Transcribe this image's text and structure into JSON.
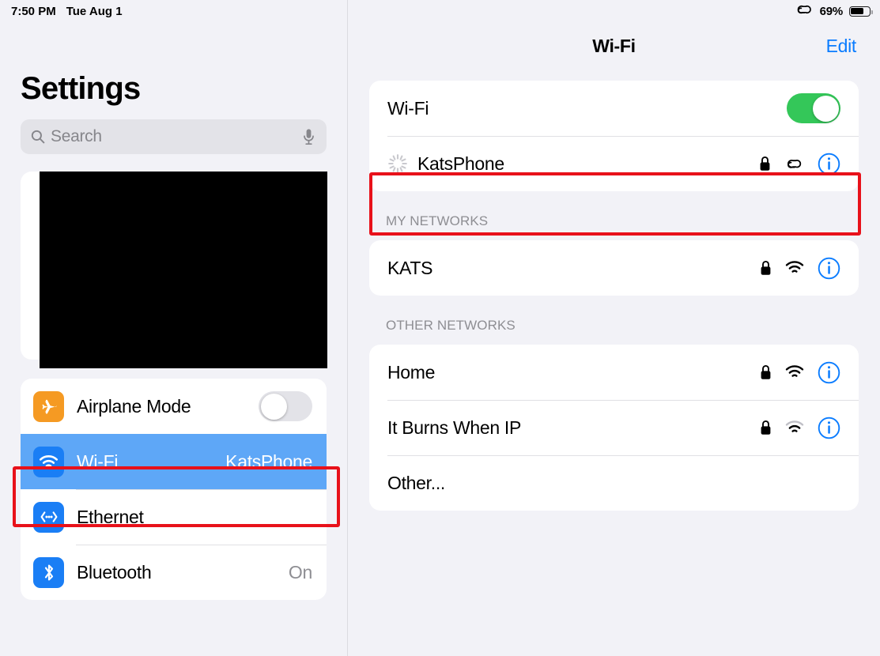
{
  "status_bar": {
    "time": "7:50 PM",
    "date": "Tue Aug 1",
    "battery_percent": "69%",
    "hotspot_icon": "hotspot-link-icon",
    "battery_icon": "battery-icon"
  },
  "sidebar": {
    "title": "Settings",
    "search": {
      "placeholder": "Search",
      "value": "",
      "icon": "search-icon",
      "dictation_icon": "microphone-icon"
    },
    "account_card": {
      "redacted": true
    },
    "items": [
      {
        "label": "Airplane Mode",
        "icon": "airplane-icon",
        "control": "toggle",
        "toggle_on": false,
        "value": ""
      },
      {
        "label": "Wi-Fi",
        "icon": "wifi-icon",
        "control": "value",
        "value": "KatsPhone",
        "selected": true
      },
      {
        "label": "Ethernet",
        "icon": "ethernet-icon",
        "control": "value",
        "value": ""
      },
      {
        "label": "Bluetooth",
        "icon": "bluetooth-icon",
        "control": "value",
        "value": "On"
      }
    ]
  },
  "detail": {
    "title": "Wi-Fi",
    "edit_label": "Edit",
    "wifi_toggle": {
      "label": "Wi-Fi",
      "on": true
    },
    "connected_network": {
      "name": "KatsPhone",
      "status_icon": "loading-spinner-icon",
      "secure_icon": "lock-icon",
      "hotspot_icon": "hotspot-link-icon",
      "info_icon": "info-circle-icon"
    },
    "sections": [
      {
        "header": "MY NETWORKS",
        "networks": [
          {
            "name": "KATS",
            "secure": true,
            "signal": 3,
            "info_icon": "info-circle-icon"
          }
        ]
      },
      {
        "header": "OTHER NETWORKS",
        "networks": [
          {
            "name": "Home",
            "secure": true,
            "signal": 3,
            "info_icon": "info-circle-icon"
          },
          {
            "name": "It Burns When IP",
            "secure": true,
            "signal": 2,
            "info_icon": "info-circle-icon"
          },
          {
            "name": "Other...",
            "secure": false,
            "signal": 0,
            "info_icon": ""
          }
        ]
      }
    ]
  },
  "annotations": {
    "color": "#e8111a",
    "boxes": [
      {
        "target": "sidebar-item-wifi"
      },
      {
        "target": "network-row-katsphone"
      }
    ]
  },
  "colors": {
    "accent_blue": "#0a7cff",
    "selected_row": "#5ea7f7",
    "toggle_on_green": "#34c759",
    "annotation_red": "#e8111a",
    "background": "#f2f2f7"
  }
}
